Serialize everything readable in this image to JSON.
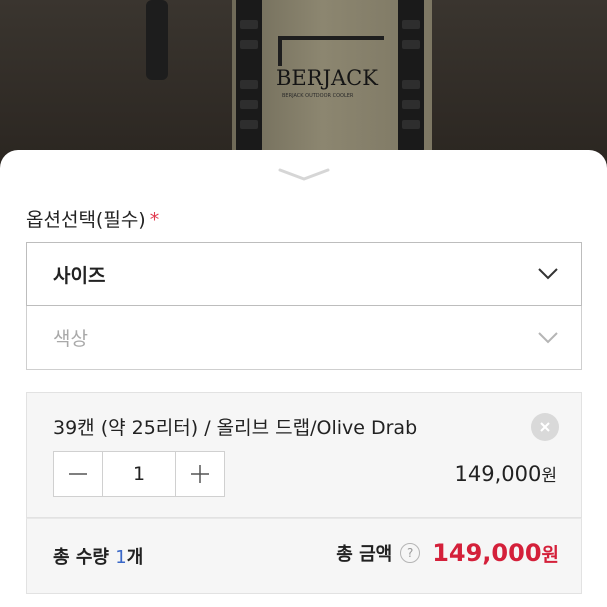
{
  "product_image": {
    "brand_text": "BERJACK",
    "brand_subtext": "BERJACK OUTDOOR COOLER"
  },
  "sheet": {
    "collapse_icon": "chevron-down-icon",
    "option_title": "옵션선택(필수)",
    "required_mark": "*",
    "selects": {
      "size": {
        "label": "사이즈",
        "icon": "chevron-down-icon"
      },
      "color": {
        "label": "색상",
        "icon": "chevron-down-icon"
      }
    },
    "selected_item": {
      "name": "39캔 (약 25리터) / 올리브 드랩/Olive Drab",
      "remove_icon": "close-icon",
      "decrement_icon": "minus-icon",
      "quantity": "1",
      "increment_icon": "plus-icon",
      "price": "149,000",
      "price_unit": "원"
    },
    "summary": {
      "quantity_label": "총 수량",
      "quantity_value": "1",
      "quantity_unit": "개",
      "amount_label": "총 금액",
      "help_icon": "question-icon",
      "help_text": "?",
      "amount_value": "149,000",
      "amount_unit": "원"
    }
  },
  "colors": {
    "accent_price": "#d4203a",
    "quantity_highlight": "#3a68c8",
    "required": "#e03a4f"
  }
}
